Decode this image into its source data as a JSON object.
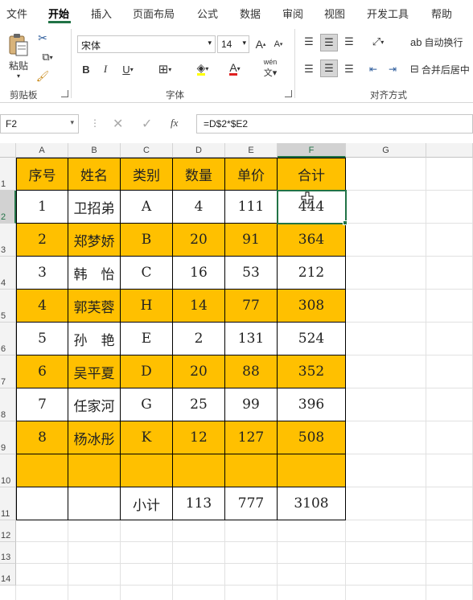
{
  "ribbon_tabs": [
    "文件",
    "开始",
    "插入",
    "页面布局",
    "公式",
    "数据",
    "审阅",
    "视图",
    "开发工具",
    "帮助"
  ],
  "clipboard": {
    "paste_label": "粘贴",
    "group_label": "剪贴板"
  },
  "font": {
    "name": "宋体",
    "size": "14",
    "group_label": "字体",
    "bold": "B",
    "italic": "I",
    "underline": "U",
    "grow": "A",
    "shrink": "A",
    "phonetic": "wén"
  },
  "alignment": {
    "wrap_label": "自动换行",
    "merge_label": "合并后居中",
    "group_label": "对齐方式"
  },
  "formula_bar": {
    "name_box": "F2",
    "formula": "=D$2*$E2",
    "fx": "fx"
  },
  "columns": [
    "A",
    "B",
    "C",
    "D",
    "E",
    "F",
    "G"
  ],
  "rows": [
    "1",
    "2",
    "3",
    "4",
    "5",
    "6",
    "7",
    "8",
    "9",
    "10",
    "11",
    "12",
    "13",
    "14"
  ],
  "selected_cell": "F2",
  "colors": {
    "accent": "#217346",
    "highlight": "#ffc000"
  },
  "table": {
    "header": [
      "序号",
      "姓名",
      "类别",
      "数量",
      "单价",
      "合计"
    ],
    "rows": [
      [
        "1",
        "卫招弟",
        "A",
        "4",
        "111",
        "444"
      ],
      [
        "2",
        "郑梦娇",
        "B",
        "20",
        "91",
        "364"
      ],
      [
        "3",
        "韩　怡",
        "C",
        "16",
        "53",
        "212"
      ],
      [
        "4",
        "郭芙蓉",
        "H",
        "14",
        "77",
        "308"
      ],
      [
        "5",
        "孙　艳",
        "E",
        "2",
        "131",
        "524"
      ],
      [
        "6",
        "吴平夏",
        "D",
        "20",
        "88",
        "352"
      ],
      [
        "7",
        "任家河",
        "G",
        "25",
        "99",
        "396"
      ],
      [
        "8",
        "杨冰彤",
        "K",
        "12",
        "127",
        "508"
      ],
      [
        "",
        "",
        "",
        "",
        "",
        ""
      ],
      [
        "",
        "",
        "小计",
        "113",
        "777",
        "3108"
      ]
    ]
  }
}
